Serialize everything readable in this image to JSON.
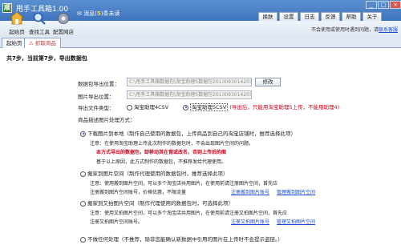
{
  "app": {
    "icon_text": "顺",
    "title": "甩手工具箱1.00"
  },
  "message": {
    "prefix": "消息(",
    "count": "5",
    "suffix": ")条未读"
  },
  "top_buttons": [
    "换肤",
    "设置",
    "日志",
    "反馈",
    "帮助",
    "关于"
  ],
  "window_buttons": [
    "_",
    "□",
    "×"
  ],
  "toolbar": {
    "home": "起始页",
    "find": "查找工具",
    "config": "配置网店"
  },
  "notice": {
    "text": "不会使用或使用时遇到问题，请",
    "link": "联系客服"
  },
  "tabs": {
    "home": "起始页",
    "active": "抓取商品"
  },
  "step": "共7步，当前第7步，导出数据包",
  "form": {
    "package_label": "数据包导出位置：",
    "package_path": "C:\\甩手工具箱数据包\\淘宝助理5数据包20130930142030.csv",
    "modify": "修改",
    "image_label": "图片导出位置：",
    "image_path": "C:\\甩手工具箱数据包\\淘宝助理5数据包20130930142030",
    "type_label": "导出文件类型：",
    "type_opt1": "淘宝助理4CSV",
    "type_opt2": "淘宝助理5CSV",
    "type_hint": "(导出后，只能用淘宝助理5上传，不能用助理4)",
    "desc_label": "商品描述图片处理方式："
  },
  "options": {
    "o1": "下载图片到本地（制作自己使用的数据包，上传商品到自己的淘宝店铺时，推荐选择此项）",
    "o1_note1": "注意：在使用淘宝助理上传此次制作的数据包时，不会出现图片空间的问题。",
    "o1_note2": "本方式导出的数据包，卸移动其在育或改名，否则上传后的图",
    "o1_note3": "基于以上原因，此方式制作的数据包，不推荐发给代理使用。",
    "o2": "搬家到图片空间（制作代理使用的数据包时，推荐选择此项）",
    "o2_note1": "注意：使用搬到图片空间，可以多个淘宝店共用图片，在使用前请注册图片空间，首先应",
    "o2_note2": "注册搬到图片空间账号，价格优惠，不限流量",
    "o2_link1": "注册搬到图片账号",
    "o2_link2": "管理搬到图片空间",
    "o3": "搬家到又拍图片空间（制作代理使用的数据包时，可选择此项）",
    "o3_note1": "注意：使用又拍图片空间，可以多个淘宝店共用图片，在使用前请注册又拍图片空间，首先应",
    "o3_note2": "注册又拍图片空间账号。",
    "o3_link1": "注册又拍图片账号",
    "o3_link2": "管理又拍图片空间",
    "o4": "不做任何处理（不推荐，除非您能确认新数据中引用的图片在上传时不会提示盗链。）"
  }
}
